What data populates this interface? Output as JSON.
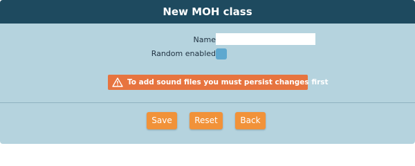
{
  "header": {
    "title": "New MOH class"
  },
  "form": {
    "name_label": "Name",
    "name_value": "",
    "random_label": "Random enabled",
    "random_checked": false
  },
  "warning": {
    "icon": "warning-triangle-icon",
    "text": "To add sound files you must persist changes first"
  },
  "buttons": {
    "save_label": "Save",
    "reset_label": "Reset",
    "back_label": "Back"
  },
  "colors": {
    "header_bg": "#1e4a5f",
    "panel_bg": "#b5d3de",
    "warning_bg": "#e7743f",
    "button_bg": "#f19239",
    "checkbox_bg": "#5ea8cf"
  }
}
